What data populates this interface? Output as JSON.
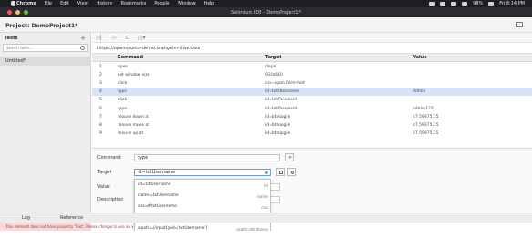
{
  "menubar": {
    "app": "Chrome",
    "items": [
      "File",
      "Edit",
      "View",
      "History",
      "Bookmarks",
      "People",
      "Window",
      "Help"
    ],
    "battery": "98%",
    "clock": "Fri 8:14 PM"
  },
  "window": {
    "title": "Selenium IDE - DemoProject1*"
  },
  "project": {
    "name": "Project: DemoProject1*"
  },
  "tests": {
    "header": "Tests",
    "search_placeholder": "Search tests...",
    "items": [
      "Untitled*"
    ]
  },
  "toolbar": {
    "url": "https://opensource-demo.orangehrmlive.com"
  },
  "table": {
    "columns": [
      "Command",
      "Target",
      "Value"
    ],
    "rows": [
      {
        "num": "1",
        "command": "open",
        "target": "/login",
        "value": ""
      },
      {
        "num": "2",
        "command": "set window size",
        "target": "930x600",
        "value": ""
      },
      {
        "num": "3",
        "command": "click",
        "target": "css=span.form-hint",
        "value": ""
      },
      {
        "num": "4",
        "command": "type",
        "target": "id=txtUsername",
        "value": "Admin"
      },
      {
        "num": "5",
        "command": "click",
        "target": "id=txtPassword",
        "value": ""
      },
      {
        "num": "6",
        "command": "type",
        "target": "id=txtPassword",
        "value": "admin123"
      },
      {
        "num": "7",
        "command": "mouse down at",
        "target": "id=btnLogin",
        "value": "47.59375,15"
      },
      {
        "num": "8",
        "command": "mouse move at",
        "target": "id=btnLogin",
        "value": "47.59375,15"
      },
      {
        "num": "9",
        "command": "mouse up at",
        "target": "id=btnLogin",
        "value": "47.59375,15"
      }
    ],
    "selected_row": 3
  },
  "editor": {
    "command_label": "Command",
    "command_value": "type",
    "target_label": "Target",
    "target_value": "id=txtUsername",
    "value_label": "Value",
    "description_label": "Description"
  },
  "dropdown": {
    "items": [
      {
        "locator": "id=txtUsername",
        "strategy": "id"
      },
      {
        "locator": "name=txtUsername",
        "strategy": "name"
      },
      {
        "locator": "css=#txtUsername",
        "strategy": "css"
      },
      {
        "locator": "css=#txtUsername",
        "strategy": "css:finder"
      },
      {
        "locator": "xpath=//input[@id='txtUsername']",
        "strategy": "xpath:attributes"
      },
      {
        "locator": "xpath=//div[@id='divUsername']/input",
        "strategy": "xpath:idRelative"
      }
    ]
  },
  "bottom": {
    "tabs": [
      "Log",
      "Reference"
    ],
    "log_message": "This element does not have property 'Text'. Please change to use an xpath"
  },
  "colors": {
    "selection": "#d6e4f5",
    "error": "#a33333"
  }
}
